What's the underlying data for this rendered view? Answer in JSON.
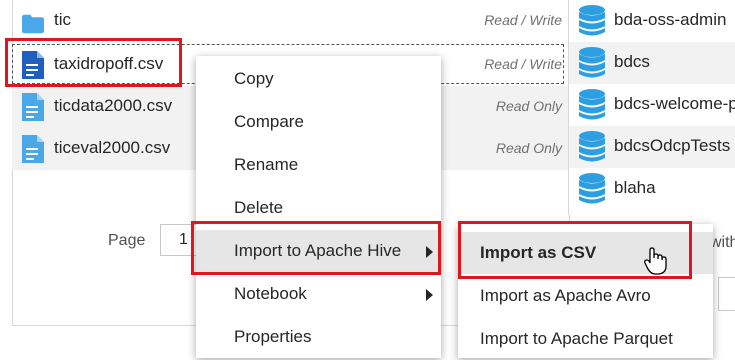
{
  "files": [
    {
      "name": "tic",
      "permission": "Read / Write",
      "icon": "folder-icon"
    },
    {
      "name": "taxidropoff.csv",
      "permission": "Read / Write",
      "icon": "file-text-icon"
    },
    {
      "name": "ticdata2000.csv",
      "permission": "Read Only",
      "icon": "file-text-icon"
    },
    {
      "name": "ticeval2000.csv",
      "permission": "Read Only",
      "icon": "file-text-icon"
    }
  ],
  "pager": {
    "label": "Page",
    "value": "1"
  },
  "databases": [
    "bda-oss-admin",
    "bdcs",
    "bdcs-welcome-p",
    "bdcsOdcpTests",
    "blaha"
  ],
  "right_partial_text": "with",
  "context_menu": {
    "items": [
      "Copy",
      "Compare",
      "Rename",
      "Delete",
      "Import to Apache Hive",
      "Notebook",
      "Properties"
    ]
  },
  "submenu": {
    "items": [
      "Import as CSV",
      "Import as Apache Avro",
      "Import to Apache Parquet"
    ]
  },
  "colors": {
    "accent_highlight": "#e0161f",
    "file_icon": "#4aa8e8",
    "selected_file_icon": "#1f5fbf",
    "db_icon": "#2d9fe0"
  }
}
